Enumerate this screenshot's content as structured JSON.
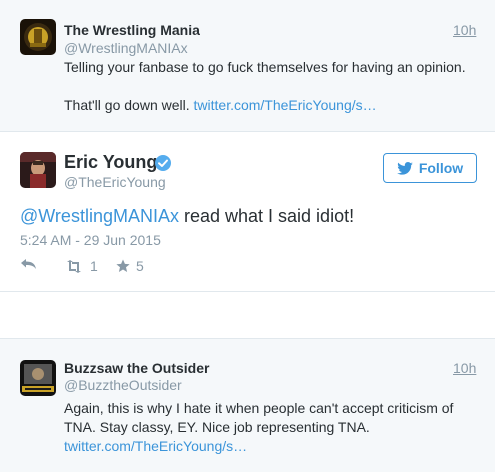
{
  "top_tweet": {
    "name": "The Wrestling Mania",
    "handle": "@WrestlingMANIAx",
    "time": "10h",
    "text_line1": "Telling your fanbase to go fuck themselves for having an opinion.",
    "text_line2_plain": "That'll go down well.",
    "link": "twitter.com/TheEricYoung/s…"
  },
  "main_tweet": {
    "name": "Eric Young",
    "handle": "@TheEricYoung",
    "follow_label": "Follow",
    "mention": "@WrestlingMANIAx",
    "text": "read what I said idiot!",
    "date": "5:24 AM - 29 Jun 2015",
    "retweet_count": "1",
    "favorite_count": "5"
  },
  "bottom_tweet": {
    "name": "Buzzsaw the Outsider",
    "handle": "@BuzztheOutsider",
    "time": "10h",
    "text_line1": "Again, this is why I hate it when people can't accept criticism of",
    "text_line2": "TNA. Stay classy, EY. Nice job representing TNA.",
    "link": "twitter.com/TheEricYoung/s…"
  },
  "colors": {
    "link": "#3b94d9",
    "muted": "#8899a6",
    "text": "#292f33",
    "context_bg": "#f5f8fa",
    "verified": "#55acee"
  },
  "icons": {
    "verified": "verified-badge-icon",
    "follow": "bird-icon",
    "reply": "reply-icon",
    "retweet": "retweet-icon",
    "favorite": "star-icon"
  }
}
